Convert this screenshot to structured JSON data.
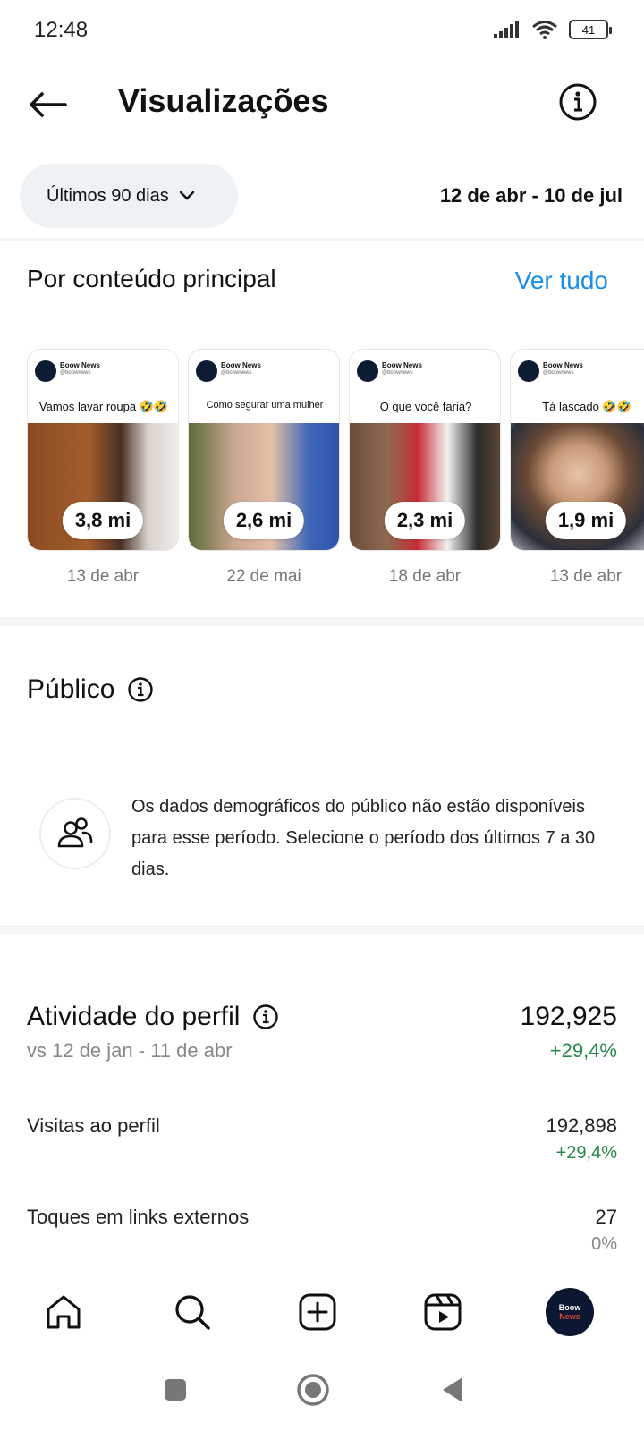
{
  "status_bar": {
    "time": "12:48",
    "battery": "41"
  },
  "header": {
    "title": "Visualizações"
  },
  "filter": {
    "period_label": "Últimos 90 dias",
    "date_range": "12 de abr - 10 de jul"
  },
  "top_content": {
    "title": "Por conteúdo principal",
    "see_all": "Ver tudo",
    "account_name": "Boow News",
    "account_handle": "@boownews",
    "items": [
      {
        "caption": "Vamos lavar roupa 🤣🤣",
        "views": "3,8 mi",
        "date": "13 de abr"
      },
      {
        "caption": "Como segurar uma mulher",
        "views": "2,6 mi",
        "date": "22 de mai"
      },
      {
        "caption": "O que você faria?",
        "views": "2,3 mi",
        "date": "18 de abr"
      },
      {
        "caption": "Tá lascado 🤣🤣",
        "views": "1,9 mi",
        "date": "13 de abr"
      }
    ]
  },
  "audience": {
    "title": "Público",
    "message": "Os dados demográficos do público não estão disponíveis para esse período. Selecione o período dos últimos 7 a 30 dias."
  },
  "profile_activity": {
    "title": "Atividade do perfil",
    "comparison": "vs 12 de jan - 11 de abr",
    "total": "192,925",
    "total_delta": "+29,4%",
    "metrics": [
      {
        "label": "Visitas ao perfil",
        "value": "192,898",
        "delta": "+29,4%"
      },
      {
        "label": "Toques em links externos",
        "value": "27",
        "delta": "0%"
      }
    ]
  },
  "nav_avatar_text": [
    "Boow",
    "News"
  ],
  "colors": {
    "link_blue": "#1a8fe8",
    "positive_green": "#28884a",
    "muted_gray": "#888888"
  }
}
